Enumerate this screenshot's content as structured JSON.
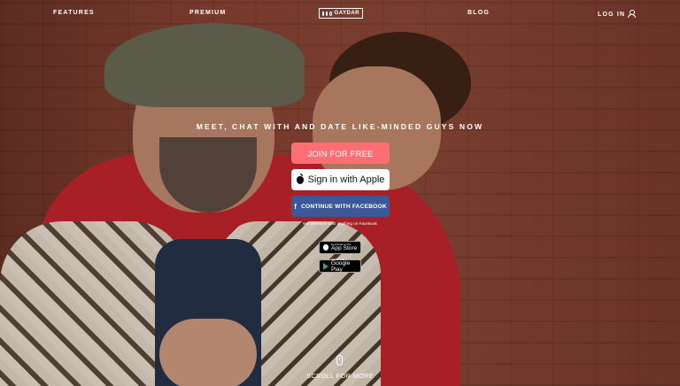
{
  "nav": {
    "features": "FEATURES",
    "premium": "PREMIUM",
    "logo_text": "GAYDAR",
    "blog": "BLOG",
    "login": "LOG IN"
  },
  "hero": {
    "tagline": "MEET, CHAT WITH AND DATE LIKE-MINDED GUYS NOW",
    "join_label": "JOIN FOR FREE",
    "apple_label": "Sign in with Apple",
    "facebook_label": "CONTINUE WITH FACEBOOK",
    "facebook_icon": "f",
    "facebook_note": "We will never post anything on Facebook"
  },
  "stores": {
    "app_store_small": "Download on the",
    "app_store_big": "App Store",
    "google_play_small": "GET IT ON",
    "google_play_big": "Google Play"
  },
  "scroll": {
    "label": "SCROLL FOR MORE"
  },
  "colors": {
    "join": "#ff6e75",
    "facebook": "#3b5998",
    "apple": "#ffffff"
  }
}
